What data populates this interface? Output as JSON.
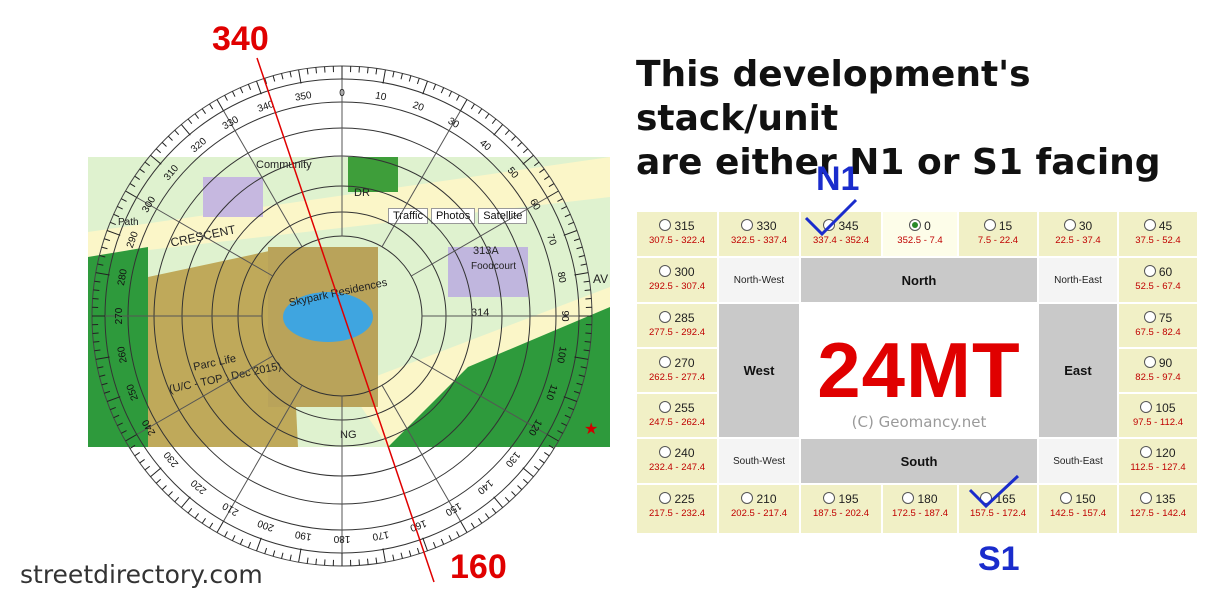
{
  "compass": {
    "top_reading": "340",
    "bottom_reading": "160",
    "watermark": "streetdirectory.com",
    "ticks_outer": [
      "0",
      "10",
      "20",
      "30",
      "40",
      "50",
      "60",
      "70",
      "80",
      "90",
      "100",
      "110",
      "120",
      "130",
      "140",
      "150",
      "160",
      "170",
      "180",
      "190",
      "200",
      "210",
      "220",
      "230",
      "240",
      "250",
      "260",
      "270",
      "280",
      "290",
      "300",
      "310",
      "320",
      "330",
      "340",
      "350"
    ]
  },
  "map": {
    "toolbar": [
      "Traffic",
      "Photos",
      "Satellite"
    ],
    "labels": [
      "Community",
      "CRESCENT",
      "Skypark Residences",
      "Parc Life",
      "(U/C - TOP : Dec 2015)",
      "313A",
      "Foodcourt",
      "314",
      "DR",
      "AV",
      "Path",
      "NG"
    ]
  },
  "headline": {
    "line1": "This development's stack/unit",
    "line2": "are either N1 or S1 facing"
  },
  "marks": {
    "n1": "N1",
    "s1": "S1"
  },
  "grid": {
    "top_row": [
      {
        "deg": "315",
        "range": "307.5 - 322.4"
      },
      {
        "deg": "330",
        "range": "322.5 - 337.4"
      },
      {
        "deg": "345",
        "range": "337.4 - 352.4"
      },
      {
        "deg": "0",
        "range": "352.5 - 7.4"
      },
      {
        "deg": "15",
        "range": "7.5 - 22.4"
      },
      {
        "deg": "30",
        "range": "22.5 - 37.4"
      },
      {
        "deg": "45",
        "range": "37.5 - 52.4"
      }
    ],
    "left_col": [
      {
        "deg": "300",
        "range": "292.5 - 307.4"
      },
      {
        "deg": "285",
        "range": "277.5 - 292.4"
      },
      {
        "deg": "270",
        "range": "262.5 - 277.4"
      },
      {
        "deg": "255",
        "range": "247.5 - 262.4"
      },
      {
        "deg": "240",
        "range": "232.4 - 247.4"
      }
    ],
    "right_col": [
      {
        "deg": "60",
        "range": "52.5 - 67.4"
      },
      {
        "deg": "75",
        "range": "67.5 - 82.4"
      },
      {
        "deg": "90",
        "range": "82.5 - 97.4"
      },
      {
        "deg": "105",
        "range": "97.5 - 112.4"
      },
      {
        "deg": "120",
        "range": "112.5 - 127.4"
      }
    ],
    "bottom_row": [
      {
        "deg": "225",
        "range": "217.5 - 232.4"
      },
      {
        "deg": "210",
        "range": "202.5 - 217.4"
      },
      {
        "deg": "195",
        "range": "187.5 - 202.4"
      },
      {
        "deg": "180",
        "range": "172.5 - 187.4"
      },
      {
        "deg": "165",
        "range": "157.5 - 172.4"
      },
      {
        "deg": "150",
        "range": "142.5 - 157.4"
      },
      {
        "deg": "135",
        "range": "127.5 - 142.4"
      }
    ],
    "selected_deg": "0",
    "dir": {
      "north_west": "North-West",
      "north": "North",
      "north_east": "North-East",
      "west": "West",
      "east": "East",
      "south_west": "South-West",
      "south": "South",
      "south_east": "South-East"
    },
    "logo": "24MT",
    "copyright": "(C) Geomancy.net"
  },
  "colors": {
    "red": "#e00000",
    "blue": "#1a2ccc",
    "cell_yellow": "#f1f0c6",
    "cell_grey": "#c9c9c9"
  }
}
